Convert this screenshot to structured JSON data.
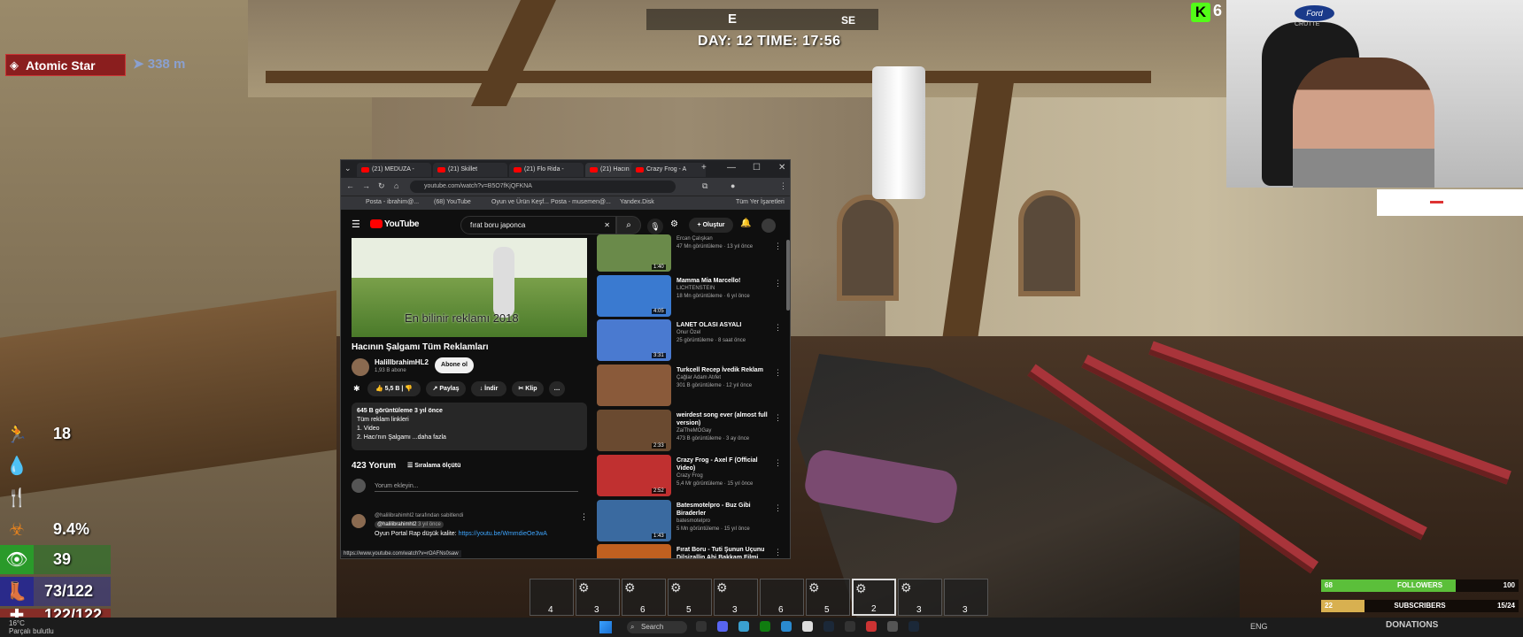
{
  "hud": {
    "compass": {
      "e": "E",
      "se": "SE"
    },
    "day_time": "DAY: 12   TIME: 17:56",
    "tracker": {
      "name": "Atomic Star",
      "distance": "338 m"
    },
    "zoom": {
      "k": "K",
      "count": "6"
    },
    "stats": [
      {
        "icon": "running-icon",
        "value": "18"
      },
      {
        "icon": "water-drop-icon",
        "value": ""
      },
      {
        "icon": "food-icon",
        "value": ""
      },
      {
        "icon": "biohazard-icon",
        "value": "9.4%"
      },
      {
        "icon": "eye-icon",
        "value": "39"
      },
      {
        "icon": "boot-icon",
        "value": "73/122"
      },
      {
        "icon": "health-icon",
        "value": "122/122"
      }
    ],
    "hotbar": [
      "4",
      "3",
      "6",
      "5",
      "3",
      "6",
      "5",
      "2",
      "3",
      "3"
    ]
  },
  "stream": {
    "followers": {
      "current": "68",
      "label": "FOLLOWERS",
      "goal": "100",
      "fill": 0.68
    },
    "subscribers": {
      "current": "22",
      "label": "SUBSCRIBERS",
      "goal": "15/24",
      "fill": 0.22
    },
    "ford": "Ford",
    "chair_brand": "CRUTTE"
  },
  "browser": {
    "tabs": [
      "(21) MEDUZA -",
      "(21) Skillet",
      "(21) Flo Rida -",
      "(21) Hacın",
      "Crazy Frog - A"
    ],
    "url": "youtube.com/watch?v=B5O7fKjQFKNA",
    "bookmarks": [
      "Posta - ibrahim@...",
      "(68) YouTube",
      "Oyun ve Ürün Keşf...",
      "Posta - musemen@...",
      "Yandex.Disk",
      "Tüm Yer İşaretleri"
    ],
    "search_query": "fırat boru japonca",
    "create_label": "Oluştur",
    "logo": "YouTube",
    "video": {
      "caption": "En bilinir reklamı 2018",
      "title": "Hacının Şalgamı Tüm Reklamları",
      "channel": "HalilIbrahimHL2",
      "subscribers": "1,93 B abone",
      "subscribe": "Abone ol",
      "likes": "5,5 B",
      "share": "Paylaş",
      "download": "İndir",
      "clip": "Klip",
      "views_line": "645 B görüntüleme  3 yıl önce",
      "desc1": "Tüm reklam linkleri",
      "desc2": "1.  Video",
      "desc3": "2.  Hacı'nın Şalgamı  ...daha fazla"
    },
    "comments": {
      "count": "423 Yorum",
      "sort": "Sıralama ölçütü",
      "add": "Yorum ekleyin...",
      "pinned": "@halilibrahimhl2 tarafından sabitlendi",
      "author": "@halilibrahimhl2",
      "age": "3 yıl önce",
      "text": "Oyun Portal Rap düşük kalite: ",
      "link": "https://youtu.be/WmmdieOe3wA"
    },
    "status_url": "https://www.youtube.com/watch?v=rOAFNs0saw",
    "recs": [
      {
        "title": "",
        "channel": "Ercan Çalışkan",
        "meta": "47 Mn görüntüleme · 13 yıl önce",
        "dur": "1:40",
        "color": "#6a8a4a"
      },
      {
        "title": "Mamma Mia Marcello!",
        "channel": "LICHTENSTEIN",
        "meta": "18 Mn görüntüleme · 6 yıl önce",
        "dur": "4:05",
        "color": "#3a7ad0"
      },
      {
        "title": "LANET OLASI ASYALI",
        "channel": "Onur Özel",
        "meta": "25 görüntüleme · 8 saat önce",
        "dur": "3:31",
        "color": "#4a7ad0"
      },
      {
        "title": "Turkcell Recep İvedik Reklam",
        "channel": "Çağlar Adam Atıfet",
        "meta": "301 B görüntüleme · 12 yıl önce",
        "dur": "",
        "color": "#8a5a3a"
      },
      {
        "title": "weirdest song ever (almost full version)",
        "channel": "ZaiTheMOGay",
        "meta": "473 B görüntüleme · 3 ay önce",
        "dur": "2:33",
        "color": "#6a4a30"
      },
      {
        "title": "Crazy Frog - Axel F (Official Video)",
        "channel": "Crazy Frog",
        "meta": "5,4 Mr görüntüleme · 15 yıl önce",
        "dur": "2:52",
        "color": "#c03030"
      },
      {
        "title": "Batesmotelpro - Buz Gibi Biraderler",
        "channel": "batesmotelpro",
        "meta": "5 Mn görüntüleme · 15 yıl önce",
        "dur": "1:43",
        "color": "#3a6aa0"
      },
      {
        "title": "Fırat Boru - Tuti Şunun Uçunu Dilsizallin Ahi Bakkam Filmi",
        "channel": "",
        "meta": "",
        "dur": "",
        "color": "#c06020"
      }
    ]
  },
  "taskbar": {
    "weather": [
      "16°C",
      "Parçalı bulutlu"
    ],
    "search": "Search",
    "donations": "DONATIONS",
    "tray": "ENG"
  }
}
